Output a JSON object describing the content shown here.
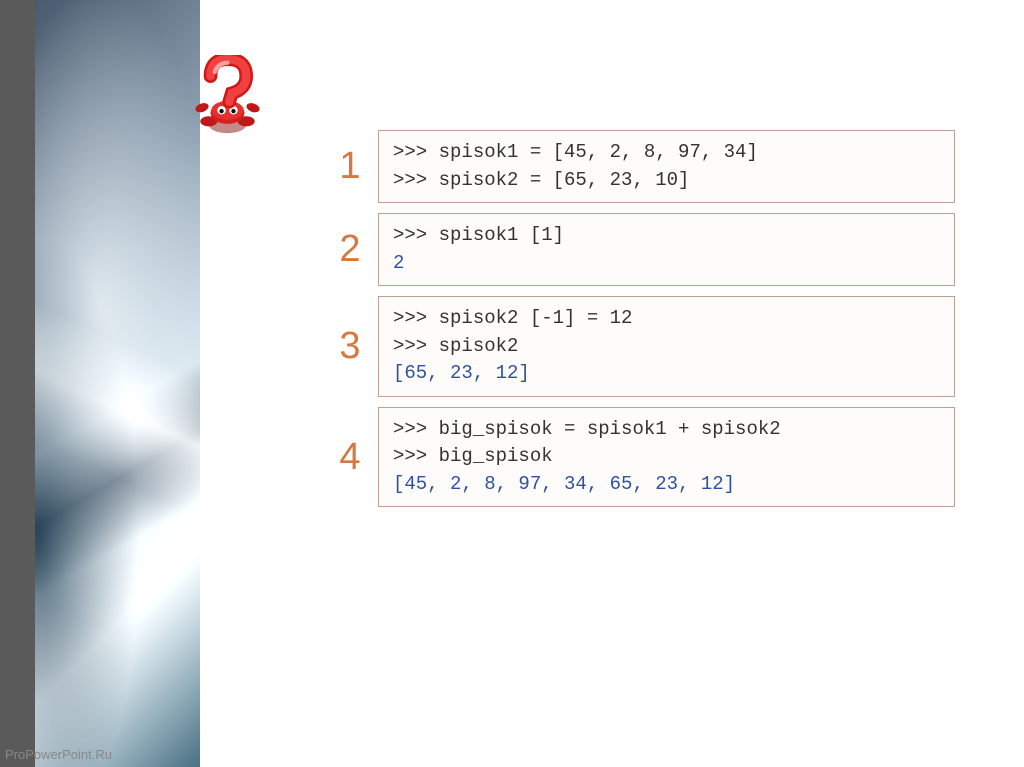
{
  "footer": "ProPowerPoint.Ru",
  "blocks": [
    {
      "number": "1",
      "lines": [
        {
          "text": ">>> spisok1 = [45, 2, 8, 97, 34]",
          "output": false
        },
        {
          "text": ">>> spisok2 = [65, 23, 10]",
          "output": false
        }
      ]
    },
    {
      "number": "2",
      "lines": [
        {
          "text": ">>> spisok1 [1]",
          "output": false
        },
        {
          "text": "2",
          "output": true
        }
      ]
    },
    {
      "number": "3",
      "lines": [
        {
          "text": ">>> spisok2 [-1] = 12",
          "output": false
        },
        {
          "text": ">>> spisok2",
          "output": false
        },
        {
          "text": "[65, 23, 12]",
          "output": true
        }
      ]
    },
    {
      "number": "4",
      "lines": [
        {
          "text": ">>> big_spisok = spisok1 + spisok2",
          "output": false
        },
        {
          "text": ">>> big_spisok",
          "output": false
        },
        {
          "text": "[45, 2, 8, 97, 34, 65, 23, 12]",
          "output": true
        }
      ]
    }
  ]
}
